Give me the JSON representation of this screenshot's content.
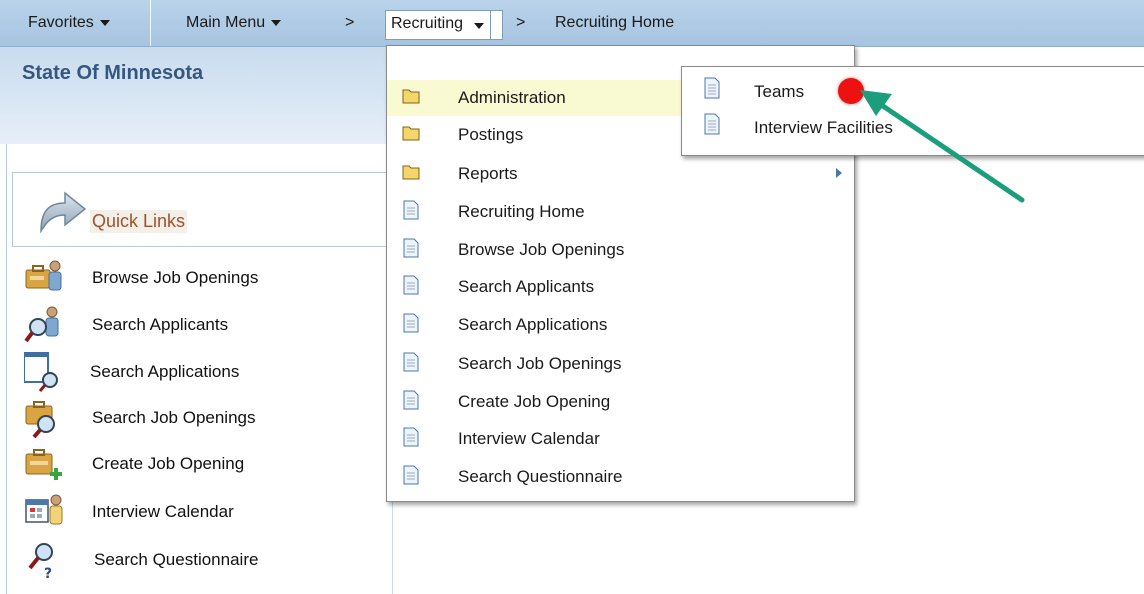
{
  "nav": {
    "favorites": "Favorites",
    "main_menu": "Main Menu",
    "separator": ">",
    "recruiting": "Recruiting",
    "breadcrumb_current": "Recruiting Home"
  },
  "header": {
    "org_title": "State Of Minnesota"
  },
  "quick_links": {
    "title": "Quick Links",
    "items": [
      {
        "label": "Browse Job Openings",
        "icon": "briefcase-person-icon"
      },
      {
        "label": "Search Applicants",
        "icon": "person-search-icon"
      },
      {
        "label": "Search Applications",
        "icon": "document-search-icon"
      },
      {
        "label": "Search Job Openings",
        "icon": "briefcase-search-icon"
      },
      {
        "label": "Create Job Opening",
        "icon": "briefcase-add-icon"
      },
      {
        "label": "Interview Calendar",
        "icon": "calendar-person-icon"
      },
      {
        "label": "Search Questionnaire",
        "icon": "questionnaire-search-icon"
      }
    ]
  },
  "menu": {
    "items": [
      {
        "label": "Administration",
        "icon": "folder-icon",
        "highlighted": true
      },
      {
        "label": "Postings",
        "icon": "folder-icon"
      },
      {
        "label": "Reports",
        "icon": "folder-icon",
        "has_submenu": true
      },
      {
        "label": "Recruiting Home",
        "icon": "page-icon"
      },
      {
        "label": "Browse Job Openings",
        "icon": "page-icon"
      },
      {
        "label": "Search Applicants",
        "icon": "page-icon"
      },
      {
        "label": "Search Applications",
        "icon": "page-icon"
      },
      {
        "label": "Search Job Openings",
        "icon": "page-icon"
      },
      {
        "label": "Create Job Opening",
        "icon": "page-icon"
      },
      {
        "label": "Interview Calendar",
        "icon": "page-icon"
      },
      {
        "label": "Search Questionnaire",
        "icon": "page-icon"
      }
    ]
  },
  "submenu": {
    "items": [
      {
        "label": "Teams",
        "icon": "page-icon"
      },
      {
        "label": "Interview Facilities",
        "icon": "page-icon"
      }
    ]
  },
  "annotation": {
    "arrow_color": "#1a9e7c",
    "dot_color": "#ee1111"
  },
  "colors": {
    "nav_bg": "#b9d3ea",
    "highlight": "#fafad2",
    "title": "#35577f",
    "quick_links_label": "#a0522d"
  }
}
